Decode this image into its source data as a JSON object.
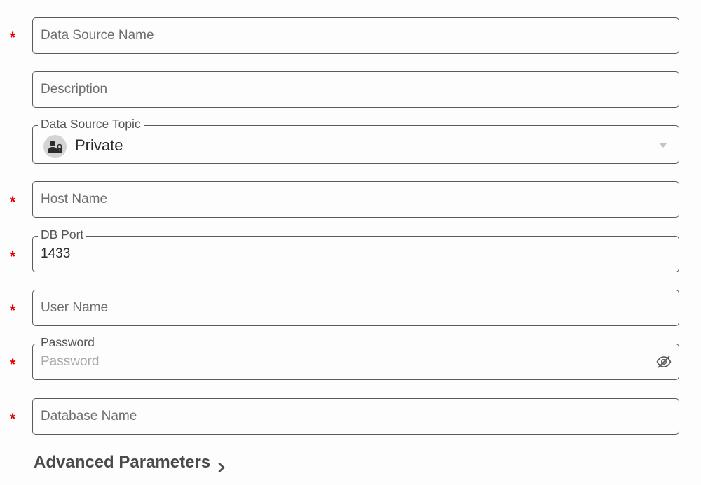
{
  "fields": {
    "data_source_name": {
      "placeholder": "Data Source Name",
      "value": "",
      "required": "*"
    },
    "description": {
      "placeholder": "Description",
      "value": ""
    },
    "topic": {
      "label": "Data Source Topic",
      "value": "Private",
      "icon": "private-user-lock-icon"
    },
    "host_name": {
      "placeholder": "Host Name",
      "value": "",
      "required": "*"
    },
    "db_port": {
      "label": "DB Port",
      "value": "1433",
      "required": "*"
    },
    "user_name": {
      "placeholder": "User Name",
      "value": "",
      "required": "*"
    },
    "password": {
      "label": "Password",
      "placeholder": "Password",
      "value": "",
      "required": "*",
      "icon": "eye-slash-icon"
    },
    "database_name": {
      "placeholder": "Database Name",
      "value": "",
      "required": "*"
    }
  },
  "advanced": {
    "label": "Advanced Parameters",
    "icon": "chevron-right-icon"
  },
  "colors": {
    "required_marker": "#e00000",
    "border": "#5a5a5a",
    "label_text": "#555555",
    "heading_text": "#4a4a4a"
  }
}
